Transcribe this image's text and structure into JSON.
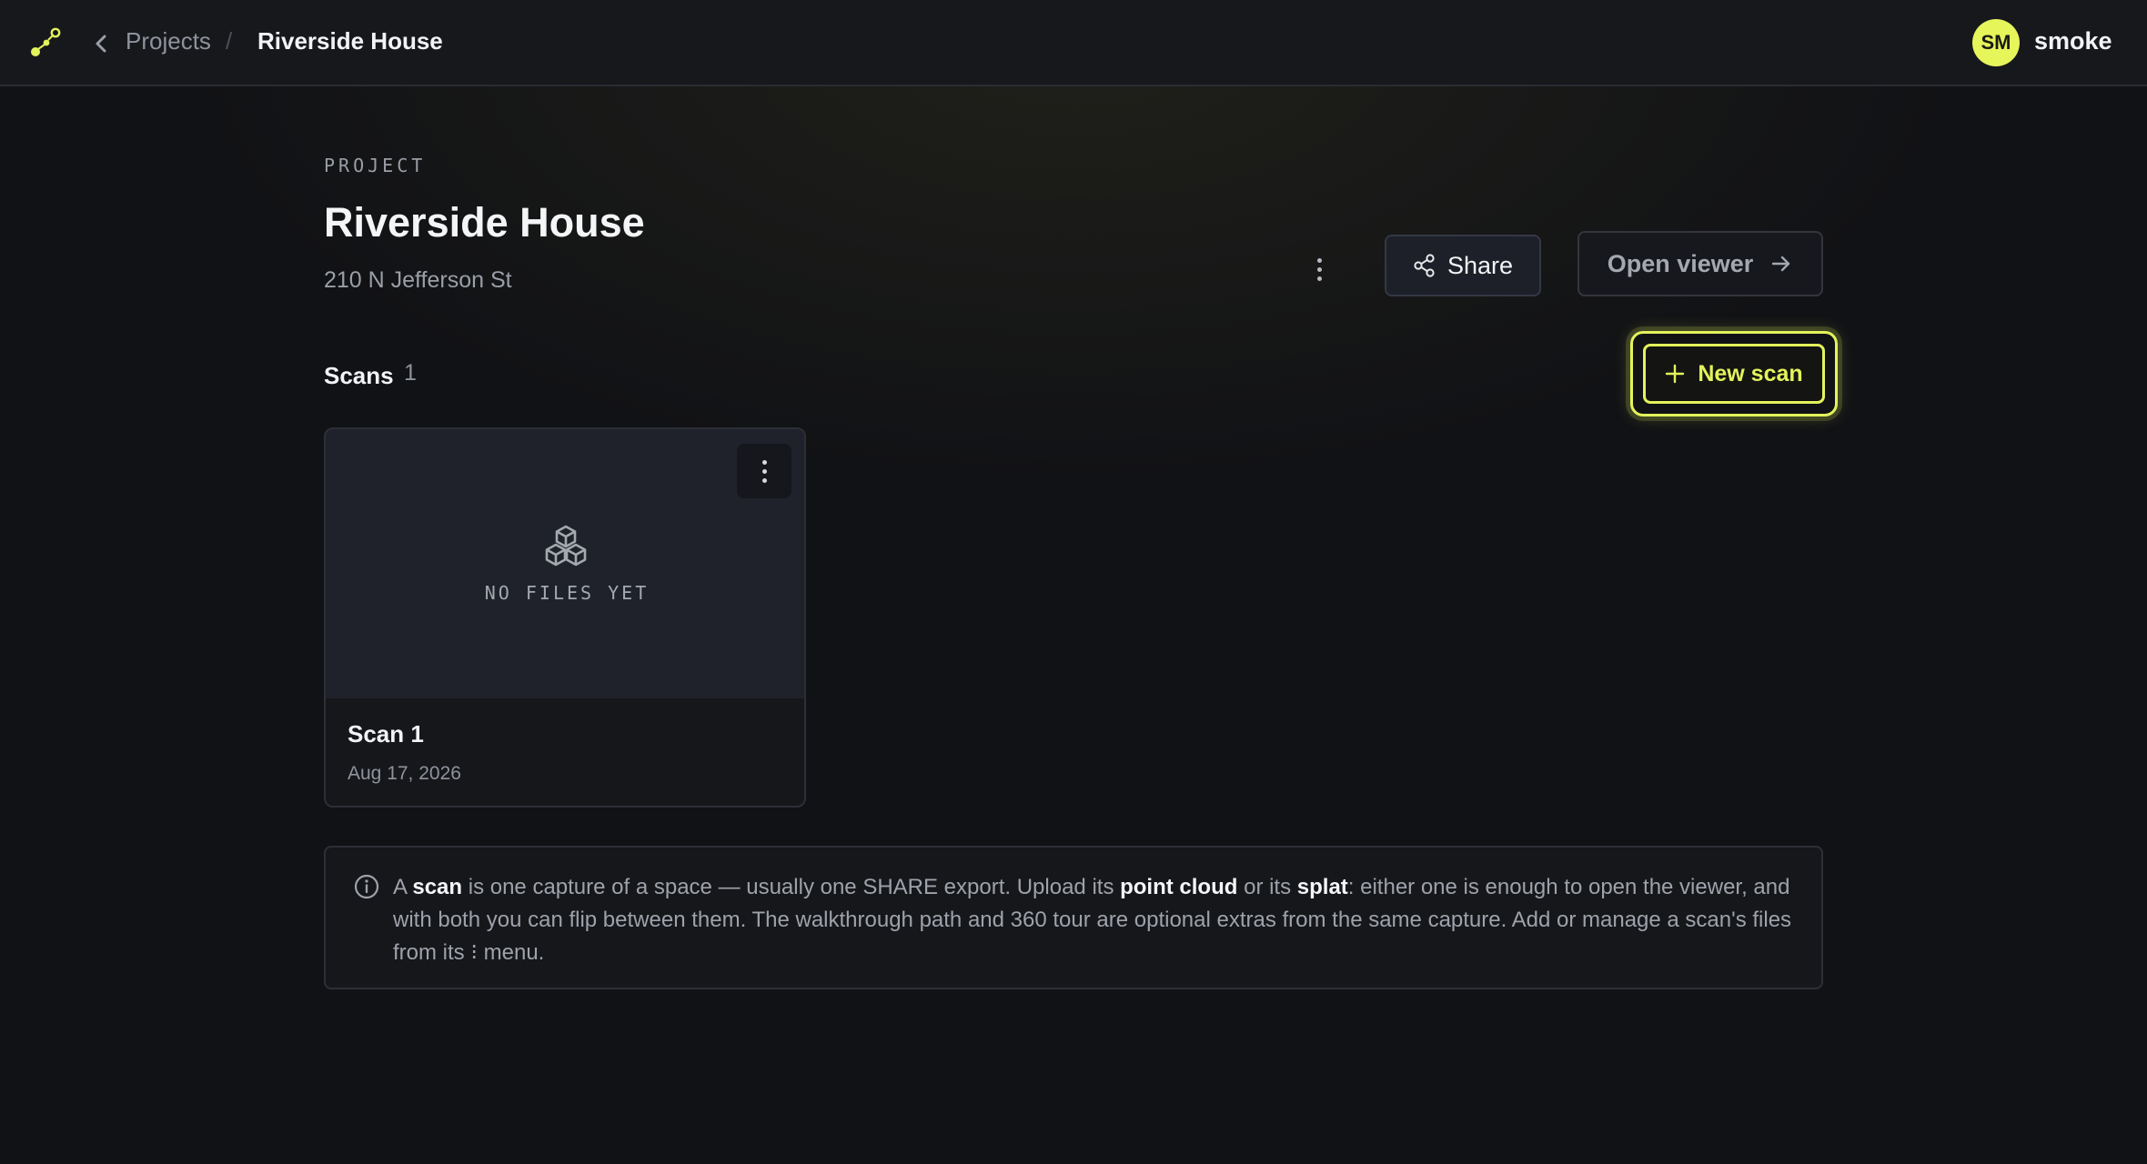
{
  "colors": {
    "accent": "#e3f35b",
    "background": "#111215",
    "topbar": "#17181c",
    "card": "#16171b",
    "muted_text": "#9a9ea6"
  },
  "topbar": {
    "logo_icon": "nodes-logo-icon",
    "back_icon": "chevron-left-icon",
    "breadcrumb": {
      "projects": "Projects",
      "separator": "/",
      "current": "Riverside House"
    },
    "user": {
      "initials": "SM",
      "name": "smoke"
    }
  },
  "header": {
    "eyebrow": "PROJECT",
    "title": "Riverside House",
    "address": "210 N Jefferson St",
    "more_icon": "kebab-vertical-icon",
    "share_label": "Share",
    "share_icon": "share-icon",
    "open_viewer_label": "Open viewer",
    "open_viewer_icon": "arrow-right-icon"
  },
  "scans": {
    "label": "Scans",
    "count": "1",
    "new_scan_label": "New scan",
    "new_scan_icon": "plus-icon",
    "items": [
      {
        "title": "Scan 1",
        "date": "Aug 17, 2026",
        "placeholder": "NO FILES YET",
        "placeholder_icon": "cubes-icon",
        "menu_icon": "kebab-vertical-icon"
      }
    ]
  },
  "info": {
    "icon": "info-circle-icon",
    "segments": [
      {
        "text": "A ",
        "bold": false
      },
      {
        "text": "scan",
        "bold": true
      },
      {
        "text": " is one capture of a space — usually one SHARE export. Upload its ",
        "bold": false
      },
      {
        "text": "point cloud",
        "bold": true
      },
      {
        "text": " or its ",
        "bold": false
      },
      {
        "text": "splat",
        "bold": true
      },
      {
        "text": ": either one is enough to open the viewer, and with both you can flip between them. The walkthrough path and 360 tour are optional extras from the same capture. Add or manage a scan's files from its ⁝ menu.",
        "bold": false
      }
    ]
  }
}
